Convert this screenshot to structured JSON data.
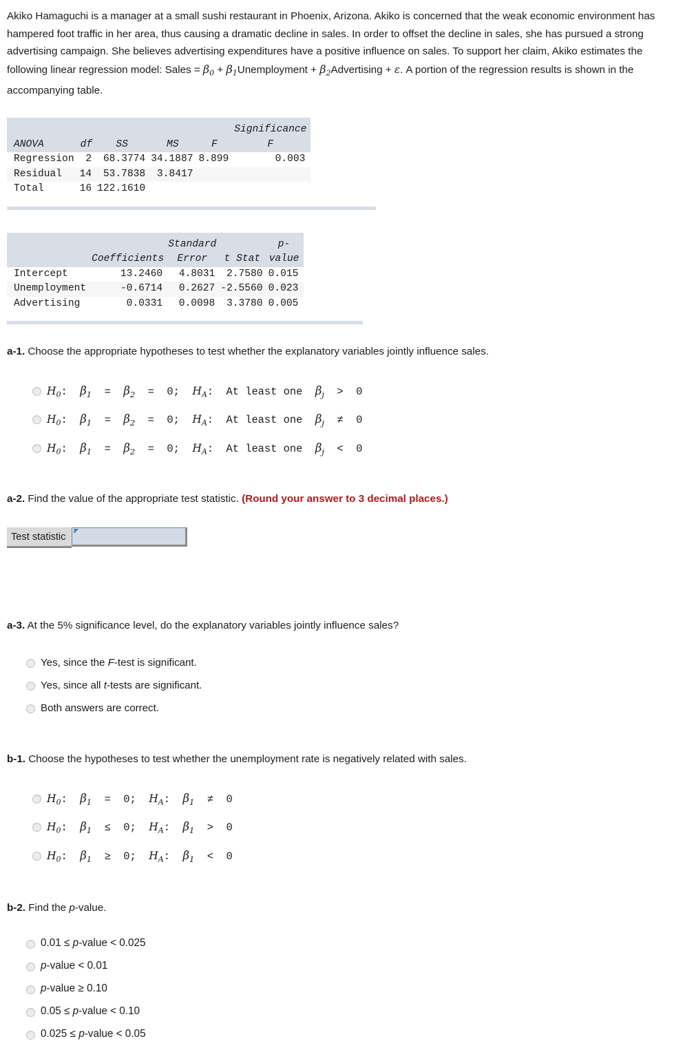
{
  "prompt": {
    "p1": "Akiko Hamaguchi is a manager at a small sushi restaurant in Phoenix, Arizona. Akiko is concerned that the weak economic environment has hampered foot traffic in her area, thus causing a dramatic decline in sales. In order to offset the decline in sales, she has pursued a strong advertising campaign. She believes advertising expenditures have a positive influence on sales. To support her claim, Akiko estimates the following linear regression model: Sales = ",
    "beta0": "β",
    "beta0_sub": "0",
    "plus1": " + ",
    "beta1": "β",
    "beta1_sub": "1",
    "term1": "Unemployment + ",
    "beta2": "β",
    "beta2_sub": "2",
    "term2": "Advertising + ",
    "epsilon": "ε",
    "p2": ". A portion of the regression results is shown in the accompanying table."
  },
  "anova_table": {
    "significance_header": "Significance",
    "headers": [
      "ANOVA",
      "df",
      "SS",
      "MS",
      "F",
      "F"
    ],
    "rows": [
      {
        "label": "Regression",
        "df": "2",
        "ss": "68.3774",
        "ms": "34.1887",
        "f": "8.899",
        "sig": "0.003"
      },
      {
        "label": "Residual",
        "df": "14",
        "ss": "53.7838",
        "ms": "3.8417",
        "f": "",
        "sig": ""
      },
      {
        "label": "Total",
        "df": "16",
        "ss": "122.1610",
        "ms": "",
        "f": "",
        "sig": ""
      }
    ]
  },
  "coef_table": {
    "header_top": [
      "",
      "",
      "Standard",
      "",
      "p-"
    ],
    "headers": [
      "",
      "Coefficients",
      "Error",
      "t Stat",
      "value"
    ],
    "rows": [
      {
        "label": "Intercept",
        "coef": "13.2460",
        "se": "4.8031",
        "t": "2.7580",
        "p": "0.015"
      },
      {
        "label": "Unemployment",
        "coef": "-0.6714",
        "se": "0.2627",
        "t": "-2.5560",
        "p": "0.023"
      },
      {
        "label": "Advertising",
        "coef": "0.0331",
        "se": "0.0098",
        "t": "3.3780",
        "p": "0.005"
      }
    ]
  },
  "a1": {
    "num": "a-1.",
    "text": " Choose the appropriate hypotheses to test whether the explanatory variables jointly influence sales.",
    "options": [
      {
        "h0": "H",
        "h0s": "0",
        "mid1": ":  ",
        "b1": "β",
        "b1s": "1",
        "eq1": "  =  ",
        "b2": "β",
        "b2s": "2",
        "eq2": "  =  0;  ",
        "ha": "H",
        "has": "A",
        "mid2": ":  At least one  ",
        "bj": "β",
        "bjs": "j",
        "tail": "  >  0"
      },
      {
        "h0": "H",
        "h0s": "0",
        "mid1": ":  ",
        "b1": "β",
        "b1s": "1",
        "eq1": "  =  ",
        "b2": "β",
        "b2s": "2",
        "eq2": "  =  0;  ",
        "ha": "H",
        "has": "A",
        "mid2": ":  At least one  ",
        "bj": "β",
        "bjs": "j",
        "tail": "  ≠  0"
      },
      {
        "h0": "H",
        "h0s": "0",
        "mid1": ":  ",
        "b1": "β",
        "b1s": "1",
        "eq1": "  =  ",
        "b2": "β",
        "b2s": "2",
        "eq2": "  =  0;  ",
        "ha": "H",
        "has": "A",
        "mid2": ":  At least one  ",
        "bj": "β",
        "bjs": "j",
        "tail": "  <  0"
      }
    ]
  },
  "a2": {
    "num": "a-2.",
    "text": " Find the value of the appropriate test statistic. ",
    "warning": "(Round your answer to 3 decimal places.)",
    "field_label": "Test statistic",
    "field_value": "",
    "field_placeholder": ""
  },
  "a3": {
    "num": "a-3.",
    "text": " At the 5% significance level, do the explanatory variables jointly influence sales?",
    "options": [
      {
        "pre": "Yes, since the ",
        "ital": "F",
        "post": "-test is significant."
      },
      {
        "pre": "Yes, since all ",
        "ital": "t",
        "post": "-tests are significant."
      },
      {
        "pre": "Both answers are correct.",
        "ital": "",
        "post": ""
      }
    ]
  },
  "b1": {
    "num": "b-1.",
    "text": " Choose the hypotheses to test whether the unemployment rate is negatively related with sales.",
    "options": [
      {
        "h0": "H",
        "h0s": "0",
        "mid1": ":  ",
        "b1": "β",
        "b1s": "1",
        "eq1": "  =  0;  ",
        "ha": "H",
        "has": "A",
        "mid2": ":  ",
        "b2": "β",
        "b2s": "1",
        "tail": "  ≠  0"
      },
      {
        "h0": "H",
        "h0s": "0",
        "mid1": ":  ",
        "b1": "β",
        "b1s": "1",
        "eq1": "  ≤  0;  ",
        "ha": "H",
        "has": "A",
        "mid2": ":  ",
        "b2": "β",
        "b2s": "1",
        "tail": "  >  0"
      },
      {
        "h0": "H",
        "h0s": "0",
        "mid1": ":  ",
        "b1": "β",
        "b1s": "1",
        "eq1": "  ≥  0;  ",
        "ha": "H",
        "has": "A",
        "mid2": ":  ",
        "b2": "β",
        "b2s": "1",
        "tail": "  <  0"
      }
    ]
  },
  "b2": {
    "num": "b-2.",
    "text": " Find the ",
    "text_ital": "p",
    "text_end": "-value.",
    "options": [
      {
        "pre": "0.01 ≤ ",
        "ital": "p",
        "post": "-value < 0.025"
      },
      {
        "pre": "",
        "ital": "p",
        "post": "-value < 0.01"
      },
      {
        "pre": "",
        "ital": "p",
        "post": "-value ≥ 0.10"
      },
      {
        "pre": "0.05 ≤ ",
        "ital": "p",
        "post": "-value < 0.10"
      },
      {
        "pre": "0.025 ≤ ",
        "ital": "p",
        "post": "-value < 0.05"
      }
    ]
  },
  "colors": {
    "table_header_bg": "#d8dde6",
    "stripe_bg": "#f6f6f7",
    "warning_red": "#b01a1a",
    "input_bg": "#d4dbe6",
    "input_border": "#6f85a8",
    "label_bg": "#d9d9d9"
  }
}
